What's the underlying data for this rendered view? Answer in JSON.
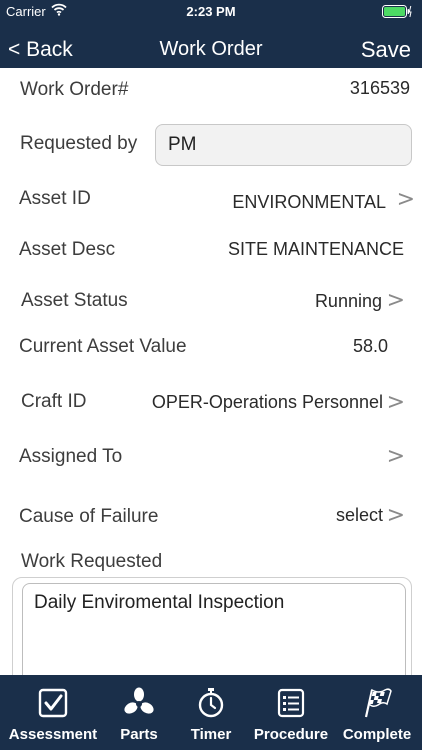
{
  "status_bar": {
    "carrier": "Carrier",
    "time": "2:23 PM"
  },
  "nav": {
    "back_label": "< Back",
    "title": "Work Order",
    "save_label": "Save"
  },
  "form": {
    "work_order": {
      "label": "Work Order#",
      "value": "316539"
    },
    "requested_by": {
      "label": "Requested by",
      "value": "PM"
    },
    "asset_id": {
      "label": "Asset ID",
      "value": "ENVIRONMENTAL"
    },
    "asset_desc": {
      "label": "Asset Desc",
      "value": "SITE MAINTENANCE"
    },
    "asset_status": {
      "label": "Asset Status",
      "value": "Running"
    },
    "current_asset_value": {
      "label": "Current Asset Value",
      "value": "58.0"
    },
    "craft_id": {
      "label": "Craft ID",
      "value": "OPER-Operations Personnel"
    },
    "assigned_to": {
      "label": "Assigned To",
      "value": ""
    },
    "cause_of_failure": {
      "label": "Cause of Failure",
      "value": "select"
    },
    "work_requested": {
      "label": "Work Requested",
      "value": "Daily Enviromental Inspection"
    }
  },
  "chevron": ">",
  "tabs": [
    {
      "label": "Assessment",
      "icon": "checkbox-icon"
    },
    {
      "label": "Parts",
      "icon": "fan-icon"
    },
    {
      "label": "Timer",
      "icon": "stopwatch-icon"
    },
    {
      "label": "Procedure",
      "icon": "list-icon"
    },
    {
      "label": "Complete",
      "icon": "checkered-flag-icon"
    }
  ],
  "colors": {
    "bar_background": "#1a2f4a",
    "battery": "#4cd964"
  }
}
